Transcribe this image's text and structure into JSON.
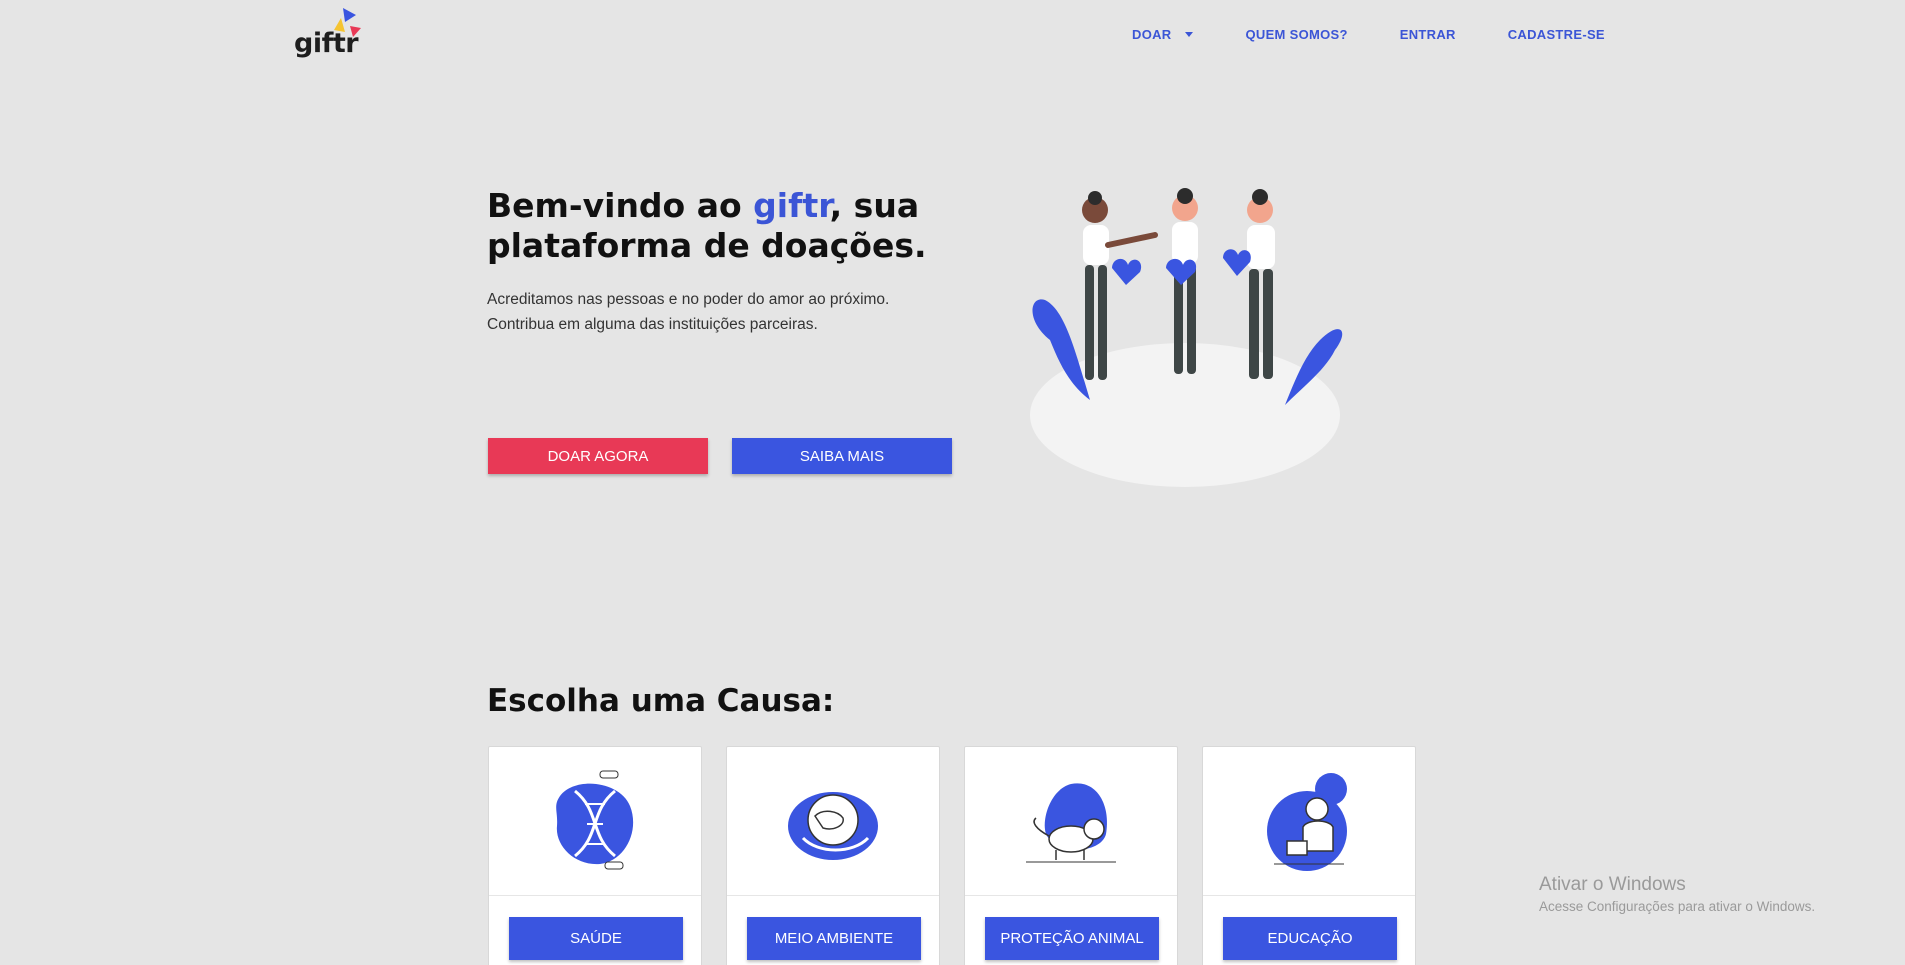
{
  "nav": {
    "logo_text": "giftr",
    "links": [
      "DOAR",
      "QUEM SOMOS?",
      "ENTRAR",
      "CADASTRE-SE"
    ]
  },
  "hero": {
    "title_prefix": "Bem-vindo ao ",
    "title_brand": "giftr",
    "title_suffix": ", sua plataforma de doações.",
    "line1": "Acreditamos nas pessoas e no poder do amor ao próximo.",
    "line2": "Contribua em alguma das instituições parceiras.",
    "btn_primary": "DOAR AGORA",
    "btn_secondary": "SAIBA MAIS"
  },
  "causes": {
    "title": "Escolha uma Causa:",
    "items": [
      {
        "label": "SAÚDE",
        "icon": "dna-icon"
      },
      {
        "label": "MEIO AMBIENTE",
        "icon": "earth-icon"
      },
      {
        "label": "PROTEÇÃO ANIMAL",
        "icon": "cat-icon"
      },
      {
        "label": "EDUCAÇÃO",
        "icon": "teacher-icon"
      }
    ]
  },
  "watermark": {
    "title": "Ativar o Windows",
    "subtitle": "Acesse Configurações para ativar o Windows."
  },
  "colors": {
    "brand_blue": "#3a55e0",
    "accent_red": "#e83956",
    "background": "#e5e5e5"
  }
}
